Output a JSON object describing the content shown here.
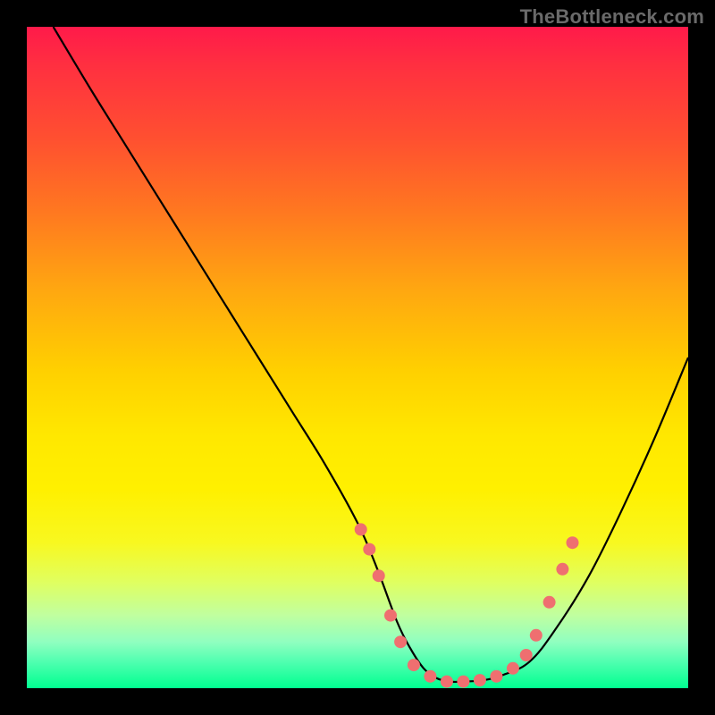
{
  "watermark": "TheBottleneck.com",
  "chart_data": {
    "type": "line",
    "title": "",
    "xlabel": "",
    "ylabel": "",
    "xlim": [
      0,
      100
    ],
    "ylim": [
      0,
      100
    ],
    "grid": false,
    "legend": false,
    "series": [
      {
        "name": "bottleneck-curve",
        "color": "#000000",
        "x": [
          4,
          10,
          15,
          20,
          25,
          30,
          35,
          40,
          45,
          50,
          53,
          56,
          58,
          60,
          62,
          64,
          66,
          69,
          72,
          76,
          80,
          85,
          90,
          95,
          100
        ],
        "y": [
          100,
          90,
          82,
          74,
          66,
          58,
          50,
          42,
          34,
          25,
          18,
          10,
          6,
          3,
          1.5,
          1,
          1,
          1.2,
          2,
          4,
          9,
          17,
          27,
          38,
          50
        ]
      }
    ],
    "markers": {
      "name": "curve-dots",
      "color": "#ef6f70",
      "radius": 7,
      "points": [
        {
          "x": 50.5,
          "y": 24
        },
        {
          "x": 51.8,
          "y": 21
        },
        {
          "x": 53.2,
          "y": 17
        },
        {
          "x": 55.0,
          "y": 11
        },
        {
          "x": 56.5,
          "y": 7
        },
        {
          "x": 58.5,
          "y": 3.5
        },
        {
          "x": 61.0,
          "y": 1.8
        },
        {
          "x": 63.5,
          "y": 1
        },
        {
          "x": 66.0,
          "y": 1
        },
        {
          "x": 68.5,
          "y": 1.2
        },
        {
          "x": 71.0,
          "y": 1.8
        },
        {
          "x": 73.5,
          "y": 3
        },
        {
          "x": 75.5,
          "y": 5
        },
        {
          "x": 77.0,
          "y": 8
        },
        {
          "x": 79.0,
          "y": 13
        },
        {
          "x": 81.0,
          "y": 18
        },
        {
          "x": 82.5,
          "y": 22
        }
      ]
    }
  }
}
